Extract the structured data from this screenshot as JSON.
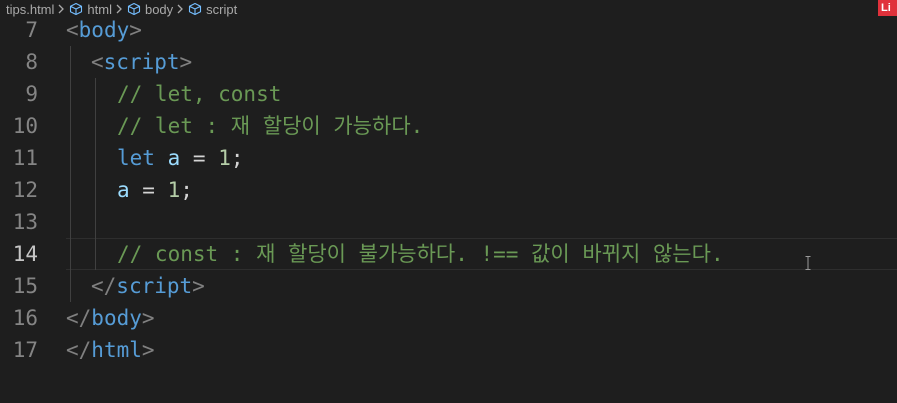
{
  "breadcrumb": {
    "file": "tips.html",
    "items": [
      "html",
      "body",
      "script"
    ]
  },
  "corner_badge": "Li",
  "colors": {
    "background": "#1e1e1e",
    "gutter": "#858585",
    "tag": "#569cd6",
    "punct": "#808080",
    "comment": "#6a9955",
    "identifier": "#9cdcfe",
    "number": "#b5cea8"
  },
  "lines": [
    {
      "number": "7",
      "tokens": [
        [
          "<",
          "punct"
        ],
        [
          "body",
          "tag"
        ],
        [
          ">",
          "punct"
        ]
      ]
    },
    {
      "number": "8",
      "tokens": [
        [
          "<",
          "punct"
        ],
        [
          "script",
          "tag"
        ],
        [
          ">",
          "punct"
        ]
      ]
    },
    {
      "number": "9",
      "tokens": [
        [
          "// let, const",
          "comment"
        ]
      ]
    },
    {
      "number": "10",
      "tokens": [
        [
          "// let : 재 할당이 가능하다.",
          "comment"
        ]
      ]
    },
    {
      "number": "11",
      "tokens": [
        [
          "let",
          "keyword"
        ],
        [
          " ",
          "plain"
        ],
        [
          "a",
          "ident"
        ],
        [
          " = ",
          "op"
        ],
        [
          "1",
          "num"
        ],
        [
          ";",
          "op"
        ]
      ]
    },
    {
      "number": "12",
      "tokens": [
        [
          "a",
          "ident"
        ],
        [
          " = ",
          "op"
        ],
        [
          "1",
          "num"
        ],
        [
          ";",
          "op"
        ]
      ]
    },
    {
      "number": "13",
      "tokens": []
    },
    {
      "number": "14",
      "tokens": [
        [
          "// const : 재 할당이 불가능하다. !== 값이 바뀌지 않는다.",
          "comment"
        ]
      ]
    },
    {
      "number": "15",
      "tokens": [
        [
          "</",
          "punct"
        ],
        [
          "script",
          "tag"
        ],
        [
          ">",
          "punct"
        ]
      ]
    },
    {
      "number": "16",
      "tokens": [
        [
          "</",
          "punct"
        ],
        [
          "body",
          "tag"
        ],
        [
          ">",
          "punct"
        ]
      ]
    },
    {
      "number": "17",
      "tokens": [
        [
          "</",
          "punct"
        ],
        [
          "html",
          "tag"
        ],
        [
          ">",
          "punct"
        ]
      ]
    }
  ]
}
